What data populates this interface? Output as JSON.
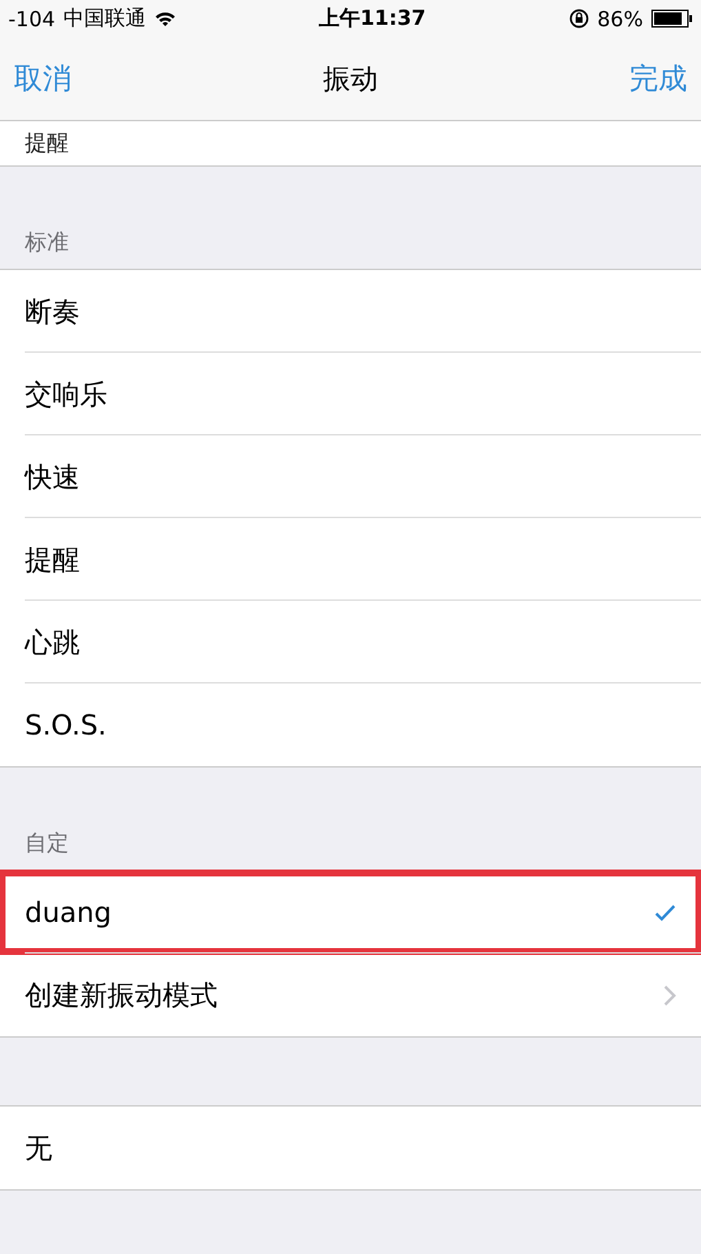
{
  "status_bar": {
    "signal": "-104",
    "carrier": "中国联通",
    "time": "上午11:37",
    "battery": "86%"
  },
  "nav": {
    "cancel": "取消",
    "title": "振动",
    "done": "完成"
  },
  "top_partial_row": {
    "label": "提醒"
  },
  "sections": [
    {
      "header": "标准",
      "items": [
        {
          "label": "断奏",
          "kind": "option",
          "selected": false,
          "highlighted": false
        },
        {
          "label": "交响乐",
          "kind": "option",
          "selected": false,
          "highlighted": false
        },
        {
          "label": "快速",
          "kind": "option",
          "selected": false,
          "highlighted": false
        },
        {
          "label": "提醒",
          "kind": "option",
          "selected": false,
          "highlighted": false
        },
        {
          "label": "心跳",
          "kind": "option",
          "selected": false,
          "highlighted": false
        },
        {
          "label": "S.O.S.",
          "kind": "option",
          "selected": false,
          "highlighted": false
        }
      ]
    },
    {
      "header": "自定",
      "items": [
        {
          "label": "duang",
          "kind": "option",
          "selected": true,
          "highlighted": true
        },
        {
          "label": "创建新振动模式",
          "kind": "link",
          "selected": false,
          "highlighted": false
        }
      ]
    },
    {
      "items": [
        {
          "label": "无",
          "kind": "option",
          "selected": false,
          "highlighted": false
        }
      ]
    }
  ]
}
